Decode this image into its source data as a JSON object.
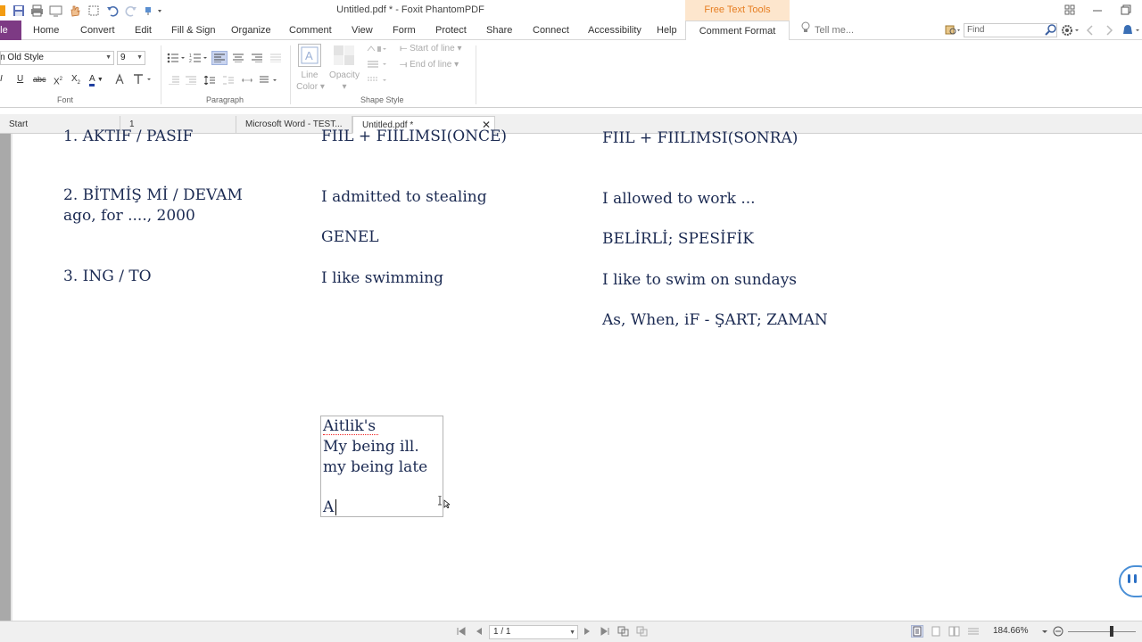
{
  "window": {
    "title": "Untitled.pdf * - Foxit PhantomPDF",
    "context_tab_title": "Free Text Tools"
  },
  "ribbon_tabs": {
    "file": "File",
    "items": [
      "Home",
      "Convert",
      "Edit",
      "Fill & Sign",
      "Organize",
      "Comment",
      "View",
      "Form",
      "Protect",
      "Share",
      "Connect",
      "Accessibility",
      "Help"
    ],
    "active": "Comment Format",
    "tell_me": "Tell me...",
    "find_placeholder": "Find"
  },
  "ribbon": {
    "font_group_label": "Font",
    "font_name": "Times New Roman Old Style",
    "font_size": "9",
    "paragraph_group_label": "Paragraph",
    "shape_group_label": "Shape Style",
    "line_color_label_1": "Line",
    "line_color_label_2": "Color",
    "opacity_label": "Opacity",
    "start_of_line": "Start of line",
    "end_of_line": "End of line"
  },
  "doc_tabs": {
    "start": "Start",
    "tab1": "1",
    "word": "Microsoft Word - TEST...",
    "untitled": "Untitled.pdf *"
  },
  "document": {
    "col1": {
      "row1": "1. AKTIF  / PASIF",
      "row2a": "2. BİTMİŞ Mİ / DEVAM",
      "row2b": "ago, for ...., 2000",
      "row3": "3. ING / TO"
    },
    "col2": {
      "row1": "FIIL + FIILIMSI(ONCE)",
      "row2": "I admitted to stealing",
      "row2b": "GENEL",
      "row3": "I like swimming"
    },
    "col3": {
      "row1": "FIIL + FIILIMSI(SONRA)",
      "row2": "I allowed to work ...",
      "row2b": "BELİRLİ; SPESİFİK",
      "row3": "I like to swim on sundays",
      "row4": "As, When, iF - ŞART; ZAMAN"
    },
    "textbox": {
      "line1": "Aitlik's",
      "line2": "My being ill.",
      "line3": "my being late",
      "line4": "A"
    }
  },
  "status": {
    "page": "1 / 1",
    "zoom": "184.66%"
  }
}
